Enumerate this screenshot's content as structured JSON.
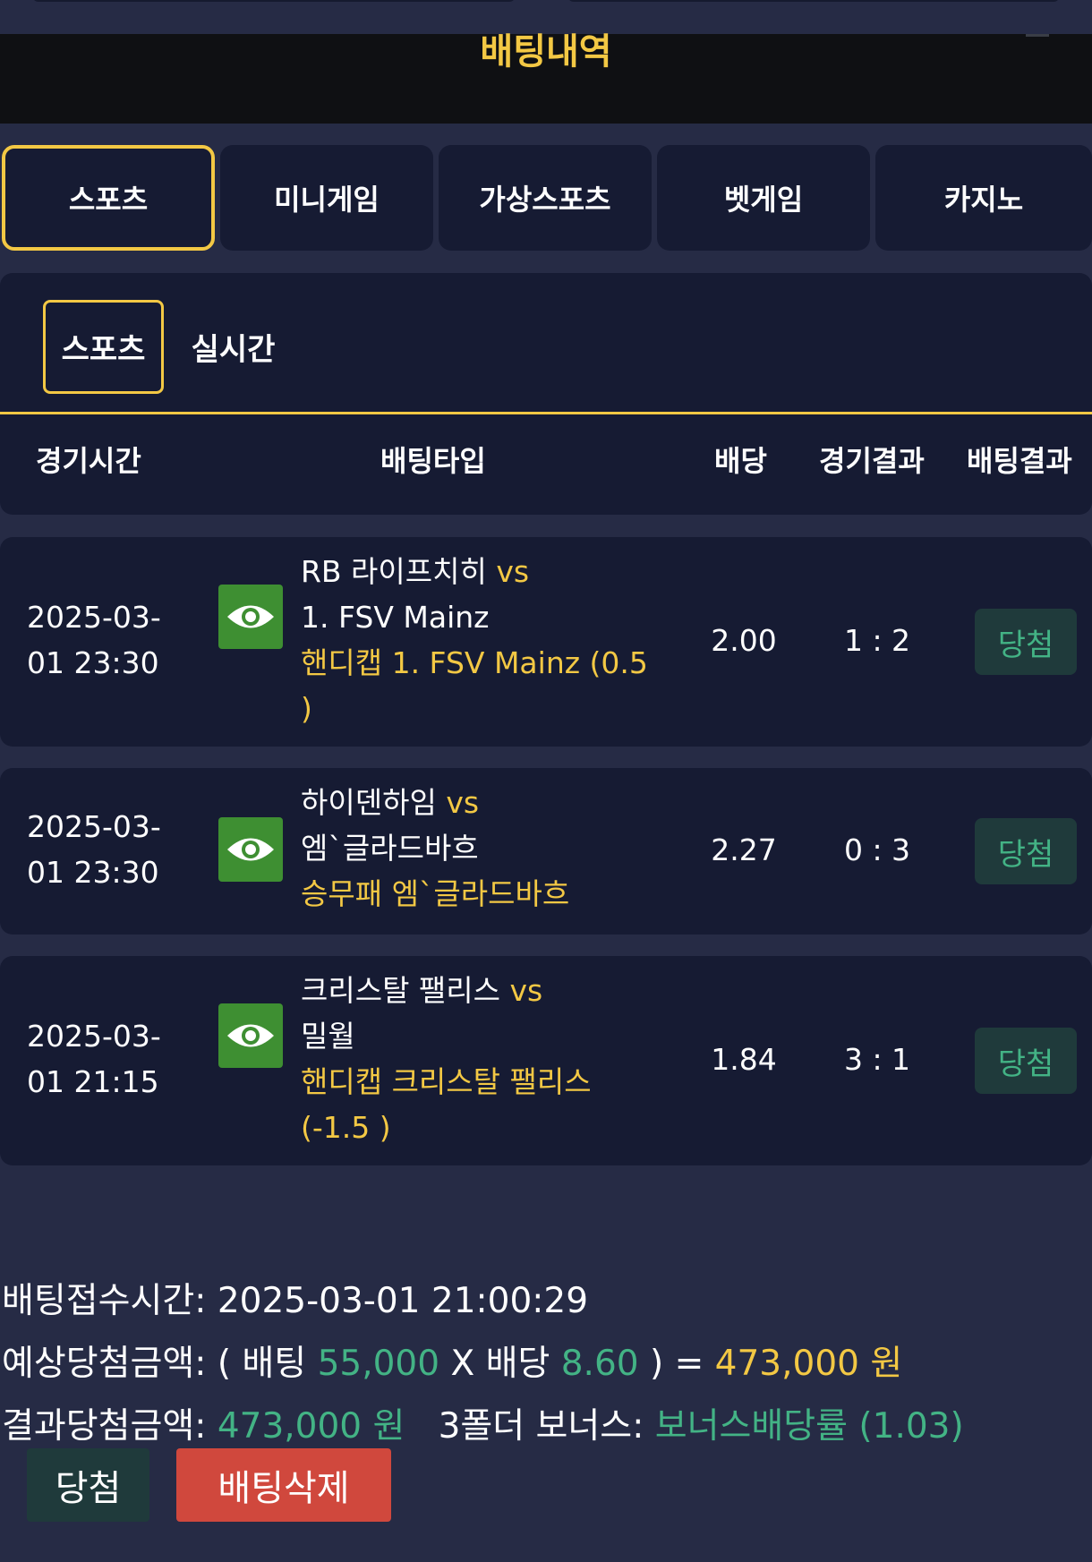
{
  "header": {
    "title": "배팅내역"
  },
  "tabs": [
    {
      "label": "스포츠",
      "active": true
    },
    {
      "label": "미니게임"
    },
    {
      "label": "가상스포츠"
    },
    {
      "label": "벳게임"
    },
    {
      "label": "카지노"
    }
  ],
  "subtabs": [
    {
      "label": "스포츠",
      "active": true
    },
    {
      "label": "실시간"
    }
  ],
  "table": {
    "headers": {
      "time": "경기시간",
      "bet_type": "배팅타입",
      "odds": "배당",
      "game_result": "경기결과",
      "bet_result": "배팅결과"
    },
    "rows": [
      {
        "time_date": "2025-03-",
        "time_clock": "01 23:30",
        "home": "RB 라이프치히",
        "vs": "vs",
        "away": "1. FSV Mainz",
        "pick_line1": "핸디캡 1. FSV Mainz (0.5",
        "pick_line2": ")",
        "odds": "2.00",
        "score": "1 : 2",
        "result": "당첨"
      },
      {
        "time_date": "2025-03-",
        "time_clock": "01 23:30",
        "home": "하이덴하임",
        "vs": "vs",
        "away": "엠`글라드바흐",
        "pick_line1": "승무패 엠`글라드바흐",
        "pick_line2": "",
        "odds": "2.27",
        "score": "0 : 3",
        "result": "당첨"
      },
      {
        "time_date": "2025-03-",
        "time_clock": "01 21:15",
        "home": "크리스탈 팰리스",
        "vs": "vs",
        "away": "밀월",
        "pick_line1": "핸디캡 크리스탈 팰리스",
        "pick_line2": "(-1.5 )",
        "odds": "1.84",
        "score": "3 : 1",
        "result": "당첨"
      }
    ]
  },
  "summary": {
    "received_label": "배팅접수시간: ",
    "received_value": "2025-03-01 21:00:29",
    "expected_label": "예상당첨금액: ( 배팅 ",
    "expected_bet": "55,000",
    "expected_mid": " X 배당 ",
    "expected_odds": "8.60",
    "expected_eq": " ) = ",
    "expected_total": "473,000 원",
    "result_label": "결과당첨금액: ",
    "result_value": "473,000 원",
    "bonus_label": "   3폴더 보너스: ",
    "bonus_value": "보너스배당률 (1.03)"
  },
  "buttons": {
    "win": "당첨",
    "delete": "배팅삭제"
  },
  "colors": {
    "accent": "#f3c844",
    "win": "#43b385",
    "delete": "#d0483d"
  },
  "icons": {
    "view": "eye-icon"
  }
}
